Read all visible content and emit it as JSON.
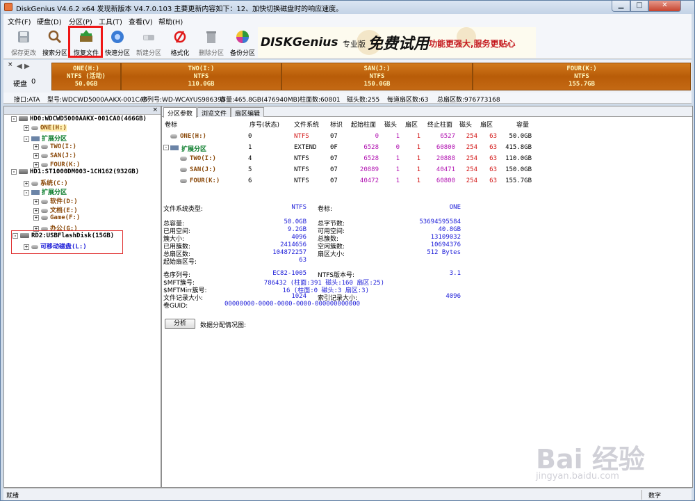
{
  "window": {
    "title": "DiskGenius V4.6.2 x64    发现新版本 V4.7.0.103 主要更新内容如下：12、加快切换磁盘时的响应速度。",
    "min": "▁",
    "max": "□",
    "close": "✕"
  },
  "menu": [
    "文件(F)",
    "硬盘(D)",
    "分区(P)",
    "工具(T)",
    "查看(V)",
    "帮助(H)"
  ],
  "toolbar": [
    {
      "label": "保存更改",
      "icon": "save-icon",
      "enabled": false
    },
    {
      "label": "搜索分区",
      "icon": "magnifier-icon",
      "enabled": true
    },
    {
      "label": "恢复文件",
      "icon": "recover-icon",
      "enabled": true
    },
    {
      "label": "快速分区",
      "icon": "quick-partition-icon",
      "enabled": true
    },
    {
      "label": "新建分区",
      "icon": "new-partition-icon",
      "enabled": false
    },
    {
      "label": "格式化",
      "icon": "format-icon",
      "enabled": true
    },
    {
      "label": "删除分区",
      "icon": "trash-icon",
      "enabled": false
    },
    {
      "label": "备份分区",
      "icon": "backup-icon",
      "enabled": true
    }
  ],
  "banner": {
    "brand": "DISKGenius",
    "edition": "专业版",
    "slogan1": "免费试用",
    "slogan2": "功能更强大,服务更贴心"
  },
  "diskbar": {
    "close": "×",
    "disk_label": "硬盘",
    "disk_num": "0",
    "segments": [
      {
        "name": "ONE(H:)",
        "fs": "NTFS (活动)",
        "size": "50.0GB"
      },
      {
        "name": "TWO(I:)",
        "fs": "NTFS",
        "size": "110.0GB"
      },
      {
        "name": "SAN(J:)",
        "fs": "NTFS",
        "size": "150.0GB"
      },
      {
        "name": "FOUR(K:)",
        "fs": "NTFS",
        "size": "155.7GB"
      }
    ]
  },
  "disk_info": {
    "iface": "接口:ATA",
    "model": "型号:WDCWD5000AAKX-001CA0",
    "serial": "序列号:WD-WCAYUS986395",
    "capacity": "容量:465.8GB(476940MB)",
    "cyl": "柱面数:60801",
    "heads": "磁头数:255",
    "spt": "每道扇区数:63",
    "total": "总扇区数:976773168"
  },
  "tree": {
    "close": "×",
    "nodes": [
      {
        "text": "HD0:WDCWD5000AAKX-001CA0(466GB)",
        "cls": "black",
        "kind": "disk"
      },
      {
        "text": "ONE(H:)",
        "cls": "brown",
        "kind": "part"
      },
      {
        "text": "扩展分区",
        "cls": "green",
        "kind": "ext"
      },
      {
        "text": "TWO(I:)",
        "cls": "brown",
        "kind": "part"
      },
      {
        "text": "SAN(J:)",
        "cls": "brown",
        "kind": "part"
      },
      {
        "text": "FOUR(K:)",
        "cls": "brown",
        "kind": "part"
      },
      {
        "text": "HD1:ST1000DM003-1CH162(932GB)",
        "cls": "black",
        "kind": "disk"
      },
      {
        "text": "系统(C:)",
        "cls": "brown",
        "kind": "part"
      },
      {
        "text": "扩展分区",
        "cls": "green",
        "kind": "ext"
      },
      {
        "text": "软件(D:)",
        "cls": "brown",
        "kind": "part"
      },
      {
        "text": "文档(E:)",
        "cls": "brown",
        "kind": "part"
      },
      {
        "text": "Game(F:)",
        "cls": "brown",
        "kind": "part"
      },
      {
        "text": "办公(G:)",
        "cls": "brown",
        "kind": "part"
      },
      {
        "text": "RD2:USBFlashDisk(15GB)",
        "cls": "black",
        "kind": "disk"
      },
      {
        "text": "可移动磁盘(L:)",
        "cls": "blue",
        "kind": "part"
      }
    ]
  },
  "tabs": [
    "分区参数",
    "浏览文件",
    "扇区编辑"
  ],
  "table": {
    "headers": [
      "卷标",
      "序号(状态)",
      "文件系统",
      "标识",
      "起始柱面",
      "磁头",
      "扇区",
      "终止柱面",
      "磁头",
      "扇区",
      "容量"
    ],
    "rows": [
      [
        "ONE(H:)",
        "0",
        "NTFS",
        "07",
        "0",
        "1",
        "1",
        "6527",
        "254",
        "63",
        "50.0GB"
      ],
      [
        "扩展分区",
        "1",
        "EXTEND",
        "0F",
        "6528",
        "0",
        "1",
        "60800",
        "254",
        "63",
        "415.8GB"
      ],
      [
        "TWO(I:)",
        "4",
        "NTFS",
        "07",
        "6528",
        "1",
        "1",
        "20888",
        "254",
        "63",
        "110.0GB"
      ],
      [
        "SAN(J:)",
        "5",
        "NTFS",
        "07",
        "20889",
        "1",
        "1",
        "40471",
        "254",
        "63",
        "150.0GB"
      ],
      [
        "FOUR(K:)",
        "6",
        "NTFS",
        "07",
        "40472",
        "1",
        "1",
        "60800",
        "254",
        "63",
        "155.7GB"
      ]
    ]
  },
  "details": {
    "fs_type_label": "文件系统类型:",
    "fs_type": "NTFS",
    "vol_label_label": "卷标:",
    "vol_label": "ONE",
    "left": [
      [
        "总容量:",
        "50.0GB"
      ],
      [
        "已用空间:",
        "9.2GB"
      ],
      [
        "簇大小:",
        "4096"
      ],
      [
        "已用簇数:",
        "2414656"
      ],
      [
        "总扇区数:",
        "104872257"
      ],
      [
        "起始扇区号:",
        "63"
      ]
    ],
    "right": [
      [
        "总字节数:",
        "53694595584"
      ],
      [
        "可用空间:",
        "40.8GB"
      ],
      [
        "总簇数:",
        "13109032"
      ],
      [
        "空闲簇数:",
        "10694376"
      ],
      [
        "扇区大小:",
        "512 Bytes"
      ]
    ],
    "serial_label": "卷序列号:",
    "serial": "EC82-1005",
    "ntfsver_label": "NTFS版本号:",
    "ntfsver": "3.1",
    "mft_label": "$MFT簇号:",
    "mft": "786432 (柱面:391 磁头:160 扇区:25)",
    "mftmirr_label": "$MFTMirr簇号:",
    "mftmirr": "16 (柱面:0 磁头:3 扇区:3)",
    "frs_label": "文件记录大小:",
    "frs": "1024",
    "idx_label": "索引记录大小:",
    "idx": "4096",
    "guid_label": "卷GUID:",
    "guid": "00000000-0000-0000-0000-000000000000",
    "analyze": "分析",
    "dist": "数据分配情况图:"
  },
  "status": {
    "left": "就绪",
    "right": "数字"
  },
  "watermark": {
    "main": "Bai 经验",
    "sub": "jingyan.baidu.com"
  }
}
